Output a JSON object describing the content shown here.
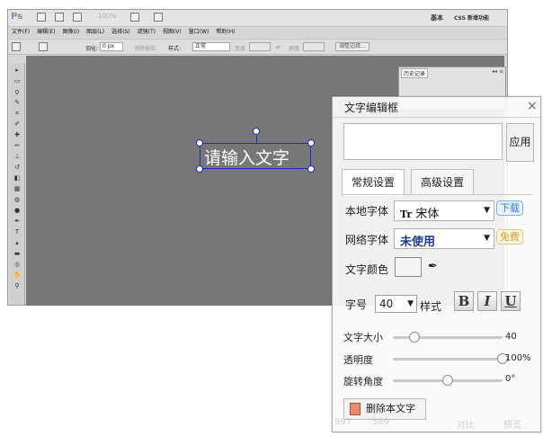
{
  "photoshop": {
    "logo": "Ps",
    "zoom": "100%",
    "workspace_basic": "基本",
    "workspace_css": "CSS 新增功能",
    "menu": [
      "文件(F)",
      "编辑(E)",
      "图像(I)",
      "图层(L)",
      "选择(S)",
      "滤镜(T)",
      "视图(V)",
      "窗口(W)",
      "帮助(H)"
    ],
    "options": {
      "feather_label": "羽化:",
      "feather_value": "0 px",
      "antialias_label": "消除锯齿",
      "style_label": "样式:",
      "style_value": "正常",
      "width_label": "宽度",
      "height_label": "高度",
      "refine_edge": "调整边缘..."
    },
    "history_tab": "历史记录",
    "canvas_text": "请输入文字"
  },
  "dialog": {
    "title": "文字编辑框",
    "close": "×",
    "apply": "应用",
    "tabs": [
      "常规设置",
      "高级设置"
    ],
    "local_font_label": "本地字体",
    "local_font_value": "宋体",
    "local_font_icon": "Tr",
    "download_tag": "下载",
    "web_font_label": "网络字体",
    "web_font_value": "未使用",
    "free_tag": "免费",
    "color_label": "文字颜色",
    "size_label": "字号",
    "size_value": "40",
    "style_label": "样式",
    "bold": "B",
    "italic": "I",
    "underline": "U",
    "sliders": [
      {
        "label": "文字大小",
        "value_text": "40",
        "fraction": 0.2
      },
      {
        "label": "透明度",
        "value_text": "100%",
        "fraction": 1.0
      },
      {
        "label": "旋转角度",
        "value_text": "0°",
        "fraction": 0.5
      }
    ],
    "delete_button": "删除本文字",
    "footer": [
      "997",
      "589",
      "对比",
      "预览"
    ]
  }
}
